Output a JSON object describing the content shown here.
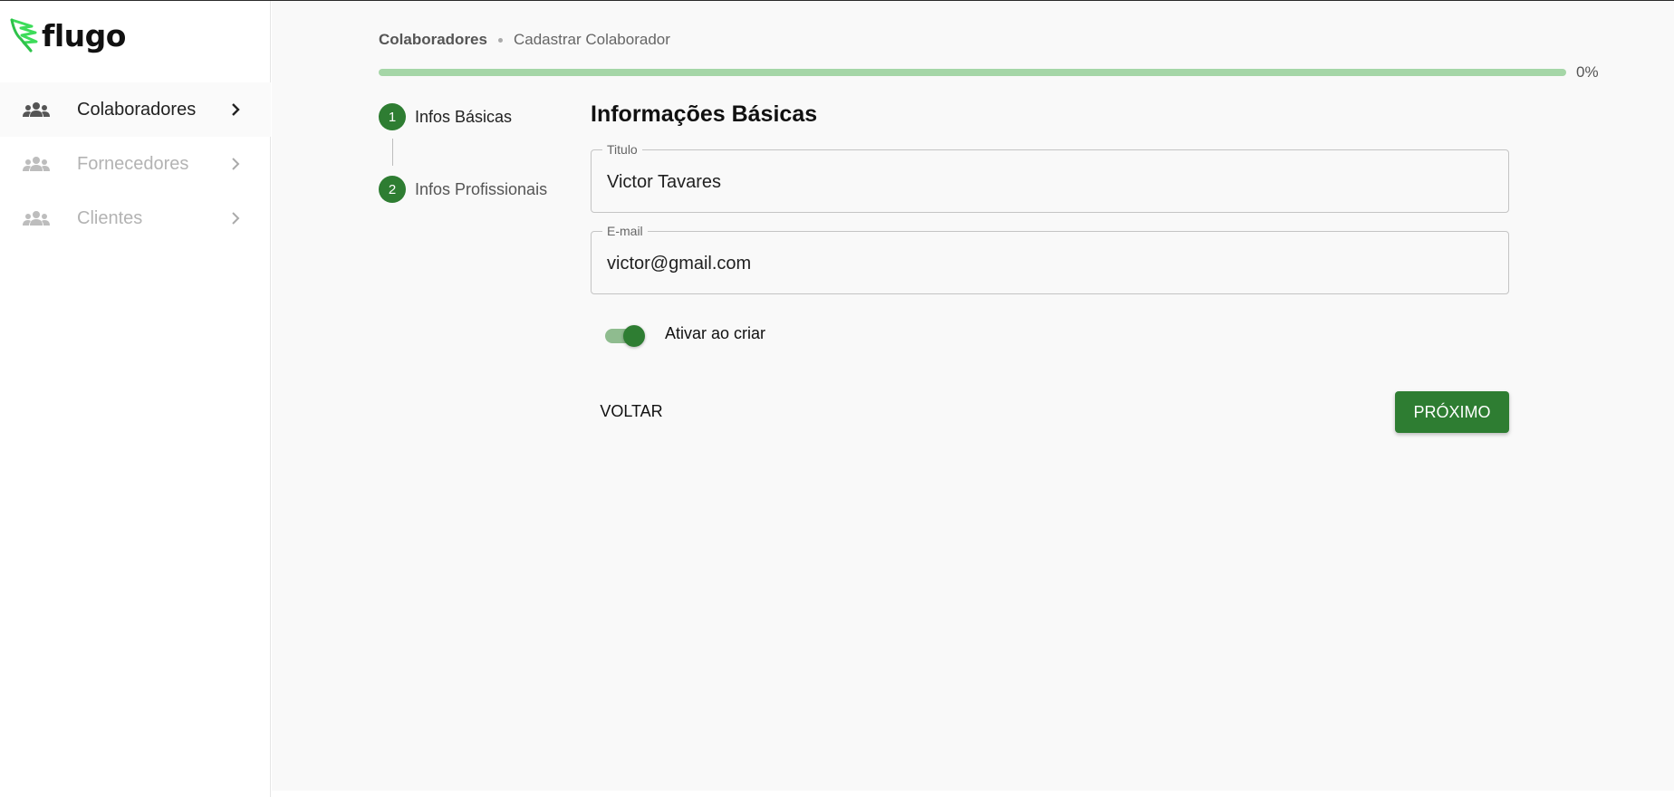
{
  "app": {
    "logo_text": "flugo"
  },
  "sidebar": {
    "items": [
      {
        "label": "Colaboradores",
        "icon": "people-icon",
        "active": true
      },
      {
        "label": "Fornecedores",
        "icon": "people-icon",
        "active": false
      },
      {
        "label": "Clientes",
        "icon": "people-icon",
        "active": false
      }
    ]
  },
  "breadcrumb": {
    "section": "Colaboradores",
    "page": "Cadastrar Colaborador"
  },
  "progress": {
    "value": 0,
    "label": "0%"
  },
  "stepper": {
    "steps": [
      {
        "number": "1",
        "label": "Infos Básicas"
      },
      {
        "number": "2",
        "label": "Infos Profissionais"
      }
    ]
  },
  "form": {
    "title": "Informações Básicas",
    "name_field": {
      "label": "Titulo",
      "value": "Victor Tavares"
    },
    "email_field": {
      "label": "E-mail",
      "value": "victor@gmail.com"
    },
    "toggle": {
      "label": "Ativar ao criar",
      "checked": true
    }
  },
  "actions": {
    "back_label": "VOLTAR",
    "next_label": "PRÓXIMO"
  },
  "colors": {
    "primary": "#2e7d32",
    "primary_light": "#a5d6a7",
    "logo_accent": "#3ddc5a"
  }
}
